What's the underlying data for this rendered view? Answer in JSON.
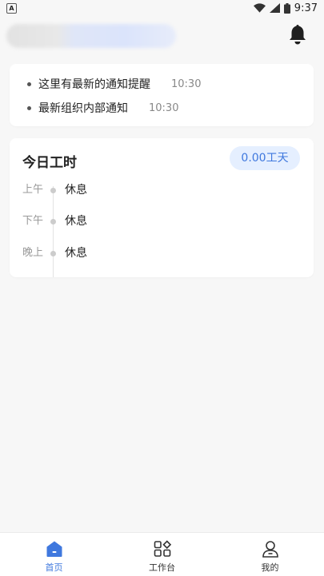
{
  "status_bar": {
    "left_icon": "A",
    "time": "9:37",
    "icons": [
      "wifi-icon",
      "signal-icon",
      "battery-icon"
    ]
  },
  "header": {
    "icons": [
      "bell-icon"
    ]
  },
  "notifications": [
    {
      "text": "这里有最新的通知提醒",
      "time": "10:30"
    },
    {
      "text": "最新组织内部通知",
      "time": "10:30"
    }
  ],
  "work_hours": {
    "title": "今日工时",
    "badge": "0.00工天",
    "rows": [
      {
        "label": "上午",
        "value": "休息"
      },
      {
        "label": "下午",
        "value": "休息"
      },
      {
        "label": "晚上",
        "value": "休息"
      }
    ]
  },
  "tabbar": {
    "tabs": [
      {
        "label": "首页",
        "icon": "home-icon",
        "active": true
      },
      {
        "label": "工作台",
        "icon": "grid-icon",
        "active": false
      },
      {
        "label": "我的",
        "icon": "user-icon",
        "active": false
      }
    ]
  },
  "colors": {
    "accent": "#3f78de",
    "badge_bg": "#e5efff",
    "page_bg": "#f7f7f7"
  }
}
